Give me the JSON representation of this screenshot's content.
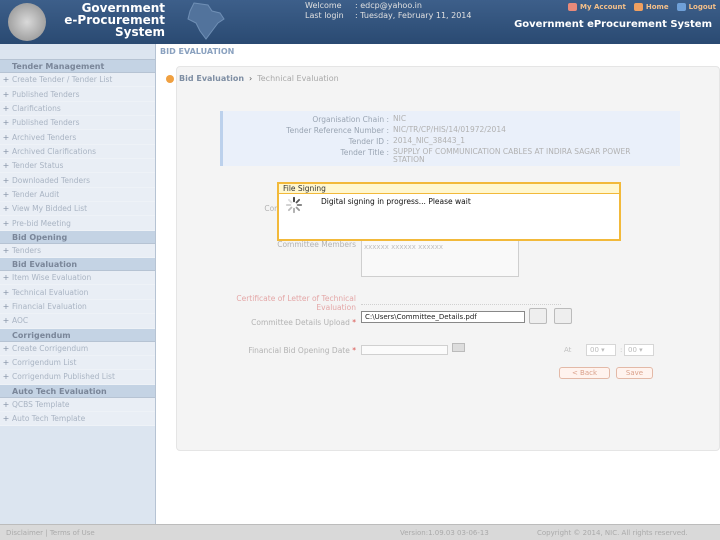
{
  "header": {
    "title_lines": [
      "Government",
      "e-Procurement",
      "System"
    ],
    "welcome_label": "Welcome",
    "welcome_value": ": edcp@yahoo.in",
    "lastlogin_label": "Last login",
    "lastlogin_value": ": Tuesday, February 11, 2014",
    "system_title": "Government eProcurement System",
    "nav": [
      {
        "label": "My Account",
        "icon": "user-icon"
      },
      {
        "label": "Home",
        "icon": "home-icon"
      },
      {
        "label": "Logout",
        "icon": "logout-icon"
      }
    ]
  },
  "sidebar": {
    "groups": [
      {
        "title": "Tender Management",
        "items": [
          "Create Tender / Tender List",
          "Published Tenders",
          "Clarifications",
          "Published Tenders",
          "Archived Tenders",
          "Archived Clarifications",
          "Tender Status",
          "Downloaded Tenders",
          "Tender Audit",
          "View My Bidded List",
          "Pre-bid Meeting"
        ]
      },
      {
        "title": "Bid Opening",
        "items": [
          "Tenders"
        ]
      },
      {
        "title": "Bid Evaluation",
        "items": [
          "Item Wise Evaluation",
          "Technical Evaluation",
          "Financial Evaluation",
          "AOC"
        ]
      },
      {
        "title": "Corrigendum",
        "items": [
          "Create Corrigendum",
          "Corrigendum List",
          "Corrigendum Published List"
        ]
      },
      {
        "title": "Auto Tech Evaluation",
        "items": [
          "QCBS Template",
          "Auto Tech Template"
        ]
      }
    ]
  },
  "main": {
    "section_title": "BID EVALUATION",
    "breadcrumb": [
      "Bid Evaluation",
      "Technical Evaluation"
    ],
    "info": [
      {
        "key": "Organisation Chain :",
        "value": "NIC"
      },
      {
        "key": "Tender Reference Number :",
        "value": "NIC/TR/CP/HIS/14/01972/2014"
      },
      {
        "key": "Tender ID :",
        "value": "2014_NIC_38443_1"
      },
      {
        "key": "Tender Title :",
        "value": "SUPPLY OF COMMUNICATION CABLES AT INDIRA SAGAR POWER STATION"
      }
    ],
    "form": {
      "committee_label": "Committee",
      "comm_members_label": "Committee Members",
      "comm_members_value": "xxxxxx xxxxxx xxxxxx",
      "sign_label": "Certificate of Letter of Technical Evaluation",
      "upload_label": "Committee Details Upload",
      "upload_value": "C:\\Users\\Committee_Details.pdf",
      "finbid_label": "Financial Bid Opening Date",
      "time_at": "At",
      "hour": "00",
      "minute": "00",
      "back_label": "< Back",
      "save_label": "Save"
    }
  },
  "modal": {
    "title": "File Signing",
    "message": "Digital signing in progress... Please wait"
  },
  "footer": {
    "disclaimer": "Disclaimer",
    "terms": "Terms of Use",
    "version": "Version:1.09.03 03-06-13",
    "copyright": "Copyright © 2014, NIC. All rights reserved."
  }
}
